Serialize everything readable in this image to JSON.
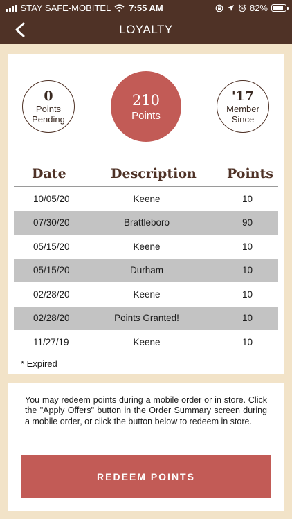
{
  "status_bar": {
    "carrier": "STAY SAFE-MOBITEL",
    "time": "7:55 AM",
    "battery": "82%",
    "battery_level": 0.82,
    "icons": [
      "signal-bars-icon",
      "wifi-icon",
      "orientation-lock-icon",
      "location-arrow-icon",
      "alarm-icon",
      "battery-icon"
    ]
  },
  "nav": {
    "title": "LOYALTY",
    "back_icon": "chevron-left-icon"
  },
  "stats": {
    "pending": {
      "value": "0",
      "label_line1": "Points",
      "label_line2": "Pending"
    },
    "points": {
      "value": "210",
      "label": "Points"
    },
    "member": {
      "value": "'17",
      "label_line1": "Member",
      "label_line2": "Since"
    }
  },
  "history": {
    "headers": {
      "date": "Date",
      "description": "Description",
      "points": "Points"
    },
    "rows": [
      {
        "date": "10/05/20",
        "description": "Keene",
        "points": "10"
      },
      {
        "date": "07/30/20",
        "description": "Brattleboro",
        "points": "90"
      },
      {
        "date": "05/15/20",
        "description": "Keene",
        "points": "10"
      },
      {
        "date": "05/15/20",
        "description": "Durham",
        "points": "10"
      },
      {
        "date": "02/28/20",
        "description": "Keene",
        "points": "10"
      },
      {
        "date": "02/28/20",
        "description": "Points Granted!",
        "points": "10"
      },
      {
        "date": "11/27/19",
        "description": "Keene",
        "points": "10"
      }
    ],
    "footnote": "* Expired"
  },
  "redeem": {
    "info": "You may redeem points during a mobile order or in store. Click the \"Apply Offers\" button in the Order Summary screen during a mobile order, or click the button below to redeem in store.",
    "button_label": "REDEEM POINTS"
  },
  "colors": {
    "header_brown": "#4f3226",
    "accent_red": "#c25b56",
    "background_tan": "#f2e3c8",
    "row_shade": "#c3c3c3"
  }
}
